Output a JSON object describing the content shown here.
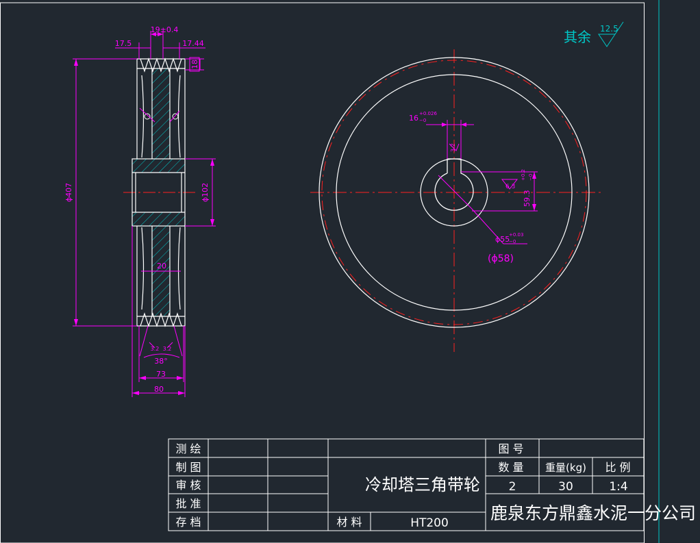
{
  "drawing": {
    "surface_roughness_note": {
      "label": "其余",
      "value": "12.5"
    },
    "side_view": {
      "dims": {
        "groove_pitch": "19±0.4",
        "left_width": "17.5",
        "right_width": "17.44",
        "groove_depth": "18",
        "outer_diameter": "ϕ407",
        "bore_diameter": "ϕ102",
        "web_thickness": "20",
        "groove_angle": "38°",
        "rim_width": "73",
        "hub_width": "80"
      },
      "roughness_marks": [
        "3.2",
        "3.2"
      ]
    },
    "front_view": {
      "dims": {
        "keyway_width": "16",
        "keyway_width_tol_upper": "+0.026",
        "keyway_width_tol_lower": "−0",
        "keyway_roughness": "3.2",
        "keyway_depth": "59.3",
        "keyway_depth_tol_upper": "+0.2",
        "keyway_depth_tol_lower": "−0",
        "bore_roughness": "6.3",
        "bore_diameter": "ϕ55",
        "bore_tol_upper": "+0.03",
        "bore_tol_lower": "−0",
        "bore_reference": "(ϕ58)"
      }
    }
  },
  "title_block": {
    "roles": [
      "测 绘",
      "制 图",
      "审 核",
      "批 准",
      "存 档"
    ],
    "part_name": "冷却塔三角带轮",
    "material_label": "材 料",
    "material_value": "HT200",
    "drawing_no_label": "图 号",
    "quantity_label": "数 量",
    "weight_label": "重量(kg)",
    "scale_label": "比 例",
    "quantity_value": "2",
    "weight_value": "30",
    "scale_value": "1:4",
    "company": "鹿泉东方鼎鑫水泥一分公司"
  },
  "colors": {
    "background": "#212830",
    "outline": "#ffffff",
    "dimension": "#ff00ff",
    "hatch": "#00c8c8",
    "centerline": "#ff2020",
    "frame": "#00c8c8"
  }
}
